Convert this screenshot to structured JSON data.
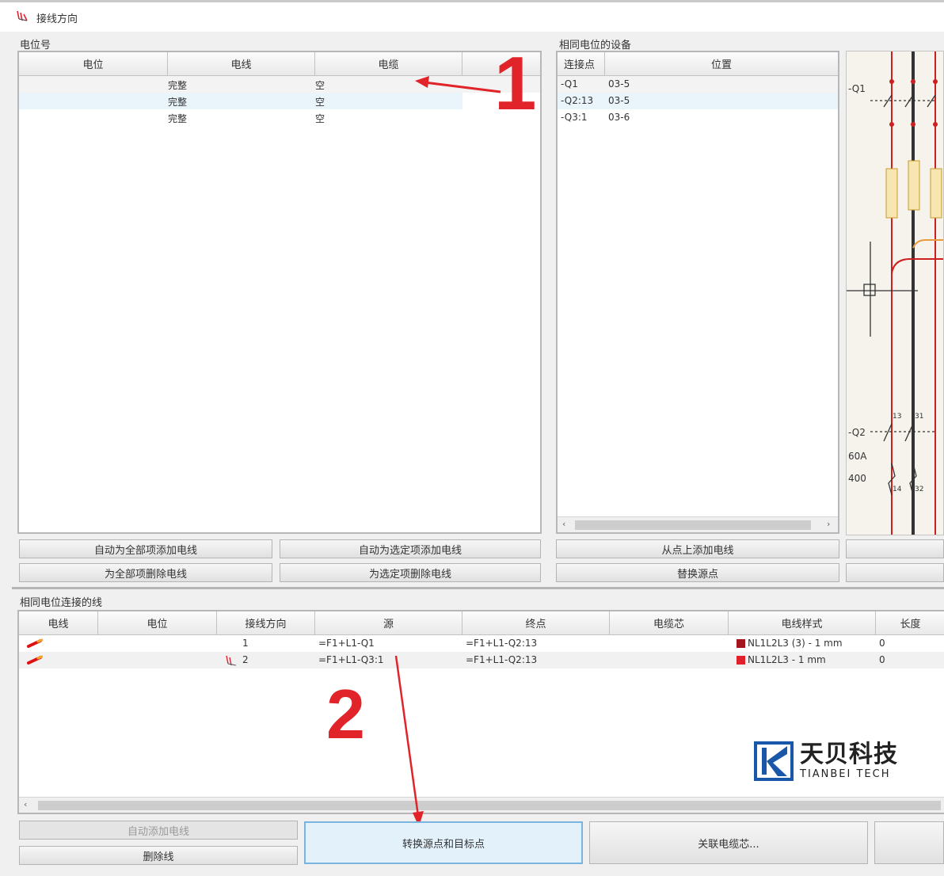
{
  "window": {
    "title": "接线方向"
  },
  "potential_panel": {
    "group_label": "电位号",
    "columns": [
      "电位",
      "电线",
      "电缆"
    ],
    "rows": [
      {
        "potential": "",
        "wire": "完整",
        "cable": "空"
      },
      {
        "potential": "",
        "wire": "完整",
        "cable": "空"
      },
      {
        "potential": "",
        "wire": "完整",
        "cable": "空"
      }
    ]
  },
  "devices_panel": {
    "group_label": "相同电位的设备",
    "columns": [
      "连接点",
      "位置"
    ],
    "rows": [
      {
        "point": "-Q1",
        "position": "03-5"
      },
      {
        "point": "-Q2:13",
        "position": "03-5"
      },
      {
        "point": "-Q3:1",
        "position": "03-6"
      }
    ]
  },
  "schematic": {
    "labels": {
      "q1": "-Q1",
      "q2": "-Q2",
      "rating1": "60A",
      "rating2": "400",
      "t13": "13",
      "t31": "31",
      "t14": "14",
      "t32": "32"
    },
    "colors": {
      "wire_red": "#cc1f1f",
      "wire_dark": "#333333",
      "orange": "#e89a3c",
      "fuse": "#f7e6b0"
    }
  },
  "buttons": {
    "auto_add_all": "自动为全部项添加电线",
    "auto_add_selected": "自动为选定项添加电线",
    "delete_all": "为全部项删除电线",
    "delete_selected": "为选定项删除电线",
    "add_from_point": "从点上添加电线",
    "replace_source": "替换源点",
    "auto_add": "自动添加电线",
    "delete_wire": "删除线",
    "swap": "转换源点和目标点",
    "assign_core": "关联电缆芯..."
  },
  "connections_panel": {
    "group_label": "相同电位连接的线",
    "columns": [
      "电线",
      "电位",
      "接线方向",
      "源",
      "终点",
      "电缆芯",
      "电线样式",
      "长度"
    ],
    "rows": [
      {
        "direction": "1",
        "source": "=F1+L1-Q1",
        "target": "=F1+L1-Q2:13",
        "style_color": "#a3161d",
        "style": "NL1L2L3 (3) - 1 mm",
        "length": "0"
      },
      {
        "direction": "2",
        "source": "=F1+L1-Q3:1",
        "target": "=F1+L1-Q2:13",
        "style_color": "#e0202a",
        "style": "NL1L2L3 - 1 mm",
        "length": "0"
      }
    ]
  },
  "annotations": {
    "step1": "1",
    "step2": "2"
  },
  "brand": {
    "name": "天贝科技",
    "sub": "TIANBEI TECH",
    "color": "#1a57a8"
  }
}
